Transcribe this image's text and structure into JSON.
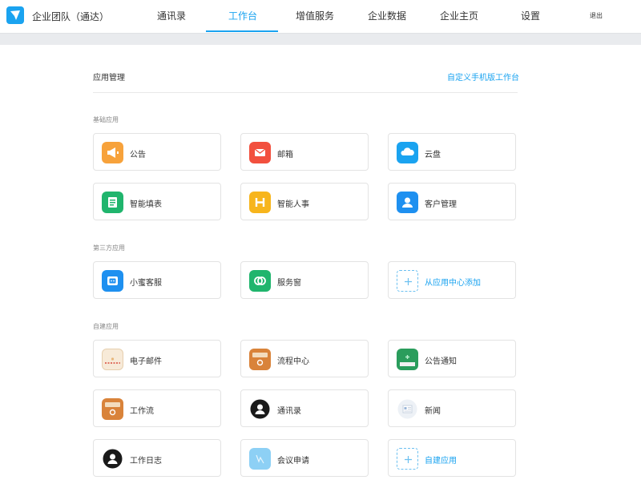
{
  "header": {
    "company": "企业团队（通达）",
    "nav": [
      "通讯录",
      "工作台",
      "增值服务",
      "企业数据",
      "企业主页",
      "设置"
    ],
    "active_nav": "工作台",
    "logout": "退出",
    "accent": "#1aa3f0"
  },
  "main": {
    "title": "应用管理",
    "customize_link": "自定义手机版工作台"
  },
  "groups": {
    "basic": {
      "label": "基础应用",
      "apps": [
        {
          "label": "公告",
          "icon": "megaphone-icon",
          "color": "#f7a23b"
        },
        {
          "label": "邮箱",
          "icon": "mail-icon",
          "color": "#f2503e"
        },
        {
          "label": "云盘",
          "icon": "cloud-icon",
          "color": "#1aa3f0"
        },
        {
          "label": "智能填表",
          "icon": "form-icon",
          "color": "#20b56d"
        },
        {
          "label": "智能人事",
          "icon": "hr-icon",
          "color": "#f7b51c"
        },
        {
          "label": "客户管理",
          "icon": "customer-icon",
          "color": "#1e90f0"
        }
      ]
    },
    "third": {
      "label": "第三方应用",
      "apps": [
        {
          "label": "小蜜客服",
          "icon": "service-bot-icon",
          "color": "#1e90f0"
        },
        {
          "label": "服务窗",
          "icon": "service-window-icon",
          "color": "#20b56d"
        }
      ],
      "add_label": "从应用中心添加"
    },
    "custom": {
      "label": "自建应用",
      "apps": [
        {
          "label": "电子邮件",
          "icon": "envelope-icon",
          "color": "#f3e0c4"
        },
        {
          "label": "流程中心",
          "icon": "flow-icon",
          "color": "#d9833a"
        },
        {
          "label": "公告通知",
          "icon": "notice-icon",
          "color": "#2a9d5c"
        },
        {
          "label": "工作流",
          "icon": "workflow-icon",
          "color": "#d9833a"
        },
        {
          "label": "通讯录",
          "icon": "contacts-icon",
          "color": "#1a1a1a"
        },
        {
          "label": "新闻",
          "icon": "news-icon",
          "color": "#e8eef6"
        },
        {
          "label": "工作日志",
          "icon": "worklog-icon",
          "color": "#1a1a1a"
        },
        {
          "label": "会议申请",
          "icon": "meeting-icon",
          "color": "#8dd0f5"
        }
      ],
      "add_label": "自建应用"
    }
  }
}
